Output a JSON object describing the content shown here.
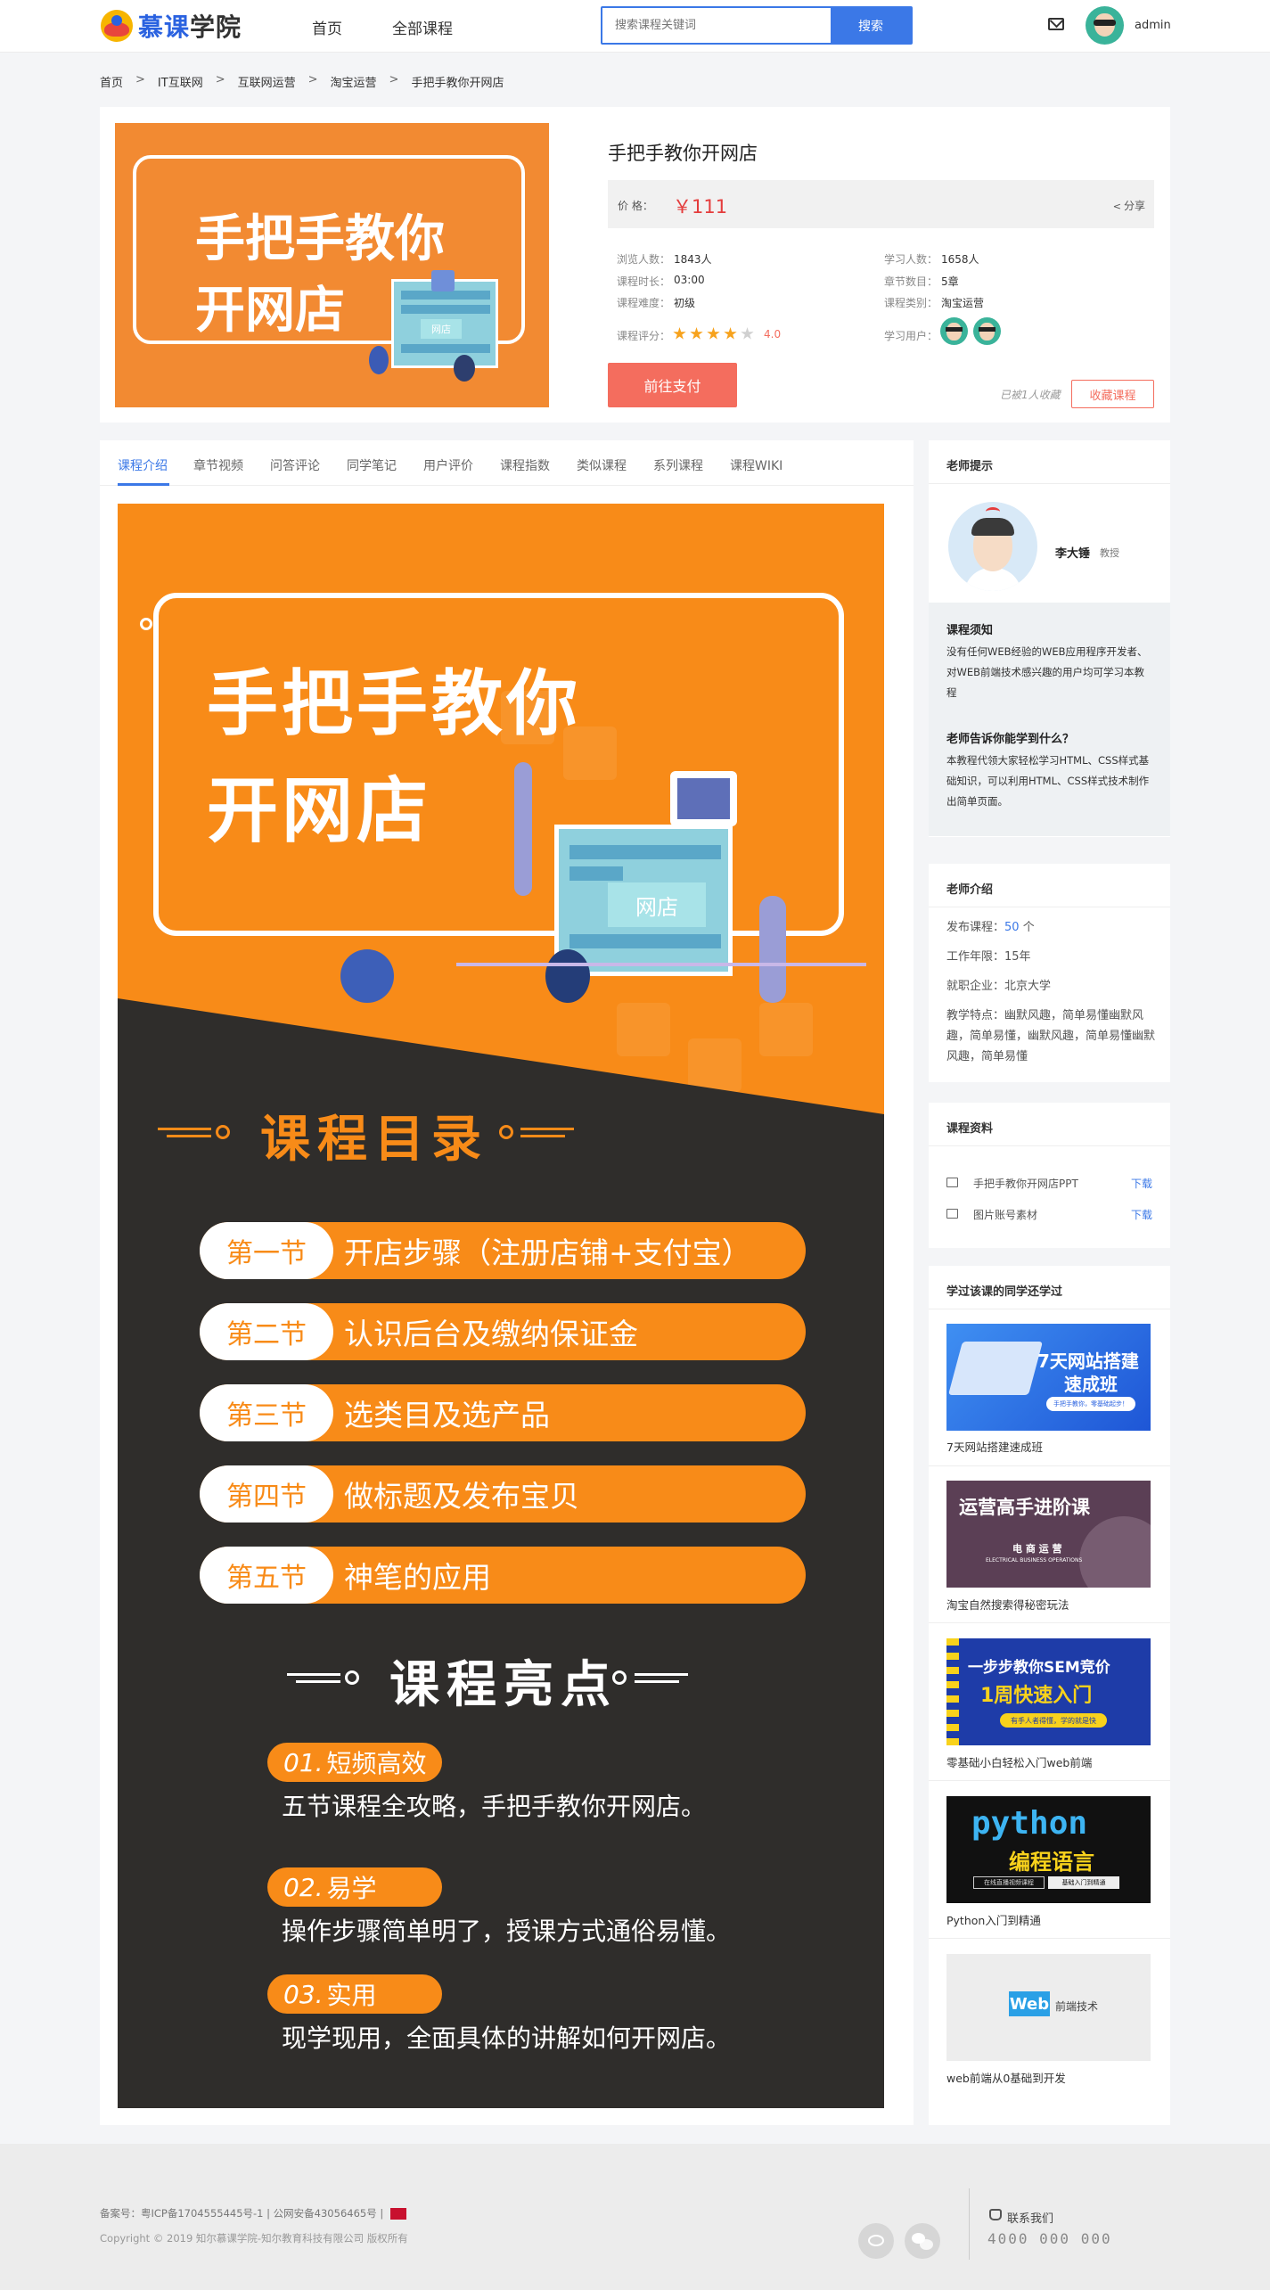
{
  "header": {
    "logo_text_1": "慕课",
    "logo_text_2": "学院",
    "nav": [
      "首页",
      "全部课程"
    ],
    "search_placeholder": "搜索课程关键词",
    "search_button": "搜索",
    "username": "admin"
  },
  "breadcrumb": [
    "首页",
    "IT互联网",
    "互联网运营",
    "淘宝运营",
    "手把手教你开网店"
  ],
  "course": {
    "cover_line1": "手把手教你",
    "cover_line2": "开网店",
    "cover_store_label": "网店",
    "title": "手把手教你开网店",
    "price_label": "价 格：",
    "price": "￥111",
    "share": "分享",
    "views_label": "浏览人数：",
    "views": "1843人",
    "learners_label": "学习人数：",
    "learners": "1658人",
    "duration_label": "课程时长：",
    "duration": "03:00",
    "chapters_label": "章节数目：",
    "chapters": "5章",
    "difficulty_label": "课程难度：",
    "difficulty": "初级",
    "category_label": "课程类别：",
    "category": "淘宝运营",
    "rating_label": "课程评分：",
    "rating": "4.0",
    "rating_value": 4,
    "rating_max": 5,
    "students_label": "学习用户：",
    "pay_button": "前往支付",
    "fav_note": "已被1人收藏",
    "fav_button": "收藏课程"
  },
  "tabs": [
    "课程介绍",
    "章节视频",
    "问答评论",
    "同学笔记",
    "用户评价",
    "课程指数",
    "类似课程",
    "系列课程",
    "课程WIKI"
  ],
  "poster": {
    "title_line1": "手把手教你",
    "title_line2": "开网店",
    "store_label": "网店",
    "catalog_heading": "课程目录",
    "sections": [
      {
        "label": "第一节",
        "text": "开店步骤（注册店铺+支付宝）"
      },
      {
        "label": "第二节",
        "text": "认识后台及缴纳保证金"
      },
      {
        "label": "第三节",
        "text": "选类目及选产品"
      },
      {
        "label": "第四节",
        "text": "做标题及发布宝贝"
      },
      {
        "label": "第五节",
        "text": "神笔的应用"
      }
    ],
    "highlights_heading": "课程亮点",
    "highlights": [
      {
        "badge_num": "01.",
        "badge_text": "短频高效",
        "text": "五节课程全攻略，手把手教你开网店。"
      },
      {
        "badge_num": "02.",
        "badge_text": "易学",
        "text": "操作步骤简单明了，授课方式通俗易懂。"
      },
      {
        "badge_num": "03.",
        "badge_text": "实用",
        "text": "现学现用，全面具体的讲解如何开网店。"
      }
    ]
  },
  "sidebar": {
    "tips_title": "老师提示",
    "teacher_name": "李大锤",
    "teacher_title": "教授",
    "notice_h1": "课程须知",
    "notice_p1": "没有任何WEB经验的WEB应用程序开发者、对WEB前端技术感兴趣的用户均可学习本教程",
    "notice_h2": "老师告诉你能学到什么？",
    "notice_p2": "本教程代领大家轻松学习HTML、CSS样式基础知识，可以利用HTML、CSS样式技术制作出简单页面。",
    "intro_title": "老师介绍",
    "intro_courses_label": "发布课程：",
    "intro_courses_num": "50",
    "intro_courses_unit": " 个",
    "intro_years": "工作年限：15年",
    "intro_company": "就职企业：北京大学",
    "intro_style": "教学特点：幽默风趣，简单易懂幽默风趣，简单易懂，幽默风趣，简单易懂幽默风趣，简单易懂",
    "resources_title": "课程资料",
    "resources": [
      {
        "name": "手把手教你开网店PPT",
        "action": "下载"
      },
      {
        "name": "图片账号素材",
        "action": "下载"
      }
    ],
    "also_title": "学过该课的同学还学过",
    "also": [
      {
        "thumb_title": "7天网站搭建",
        "thumb_title2": "速成班",
        "thumb_sub": "手把手教你，零基础起步！",
        "caption": "7天网站搭建速成班"
      },
      {
        "thumb_title": "运营高手进阶课",
        "thumb_sub": "电 商 运 营",
        "thumb_sub2": "ELECTRICAL BUSINESS OPERATIONS",
        "caption": "淘宝自然搜索得秘密玩法"
      },
      {
        "thumb_title": "一步步教你SEM竞价",
        "thumb_title2": "1周快速入门",
        "thumb_sub": "有手人者得懂，学的就是快",
        "caption": "零基础小白轻松入门web前端"
      },
      {
        "thumb_title": "python",
        "thumb_title2": "编程语言",
        "thumb_sub": "在线直播视频课程",
        "thumb_sub2": "基础入门到精通",
        "caption": "Python入门到精通"
      },
      {
        "thumb_title": "Web",
        "thumb_title2": "前端技术",
        "caption": "web前端从0基础到开发"
      }
    ]
  },
  "footer": {
    "icp": "备案号：粤ICP备1704555445号-1  |  公网安备43056465号  |",
    "copyright": "Copyright © 2019 知尔慕课学院-知尔教育科技有限公司 版权所有",
    "contact_label": "联系我们",
    "phone": "4000 000 000"
  },
  "colors": {
    "accent": "#3b78e7",
    "price": "#e43c3c",
    "poster_orange": "#f88b18",
    "poster_dark": "#2f2d2b",
    "pay_button": "#f46d5e",
    "star": "#f7a21c"
  }
}
